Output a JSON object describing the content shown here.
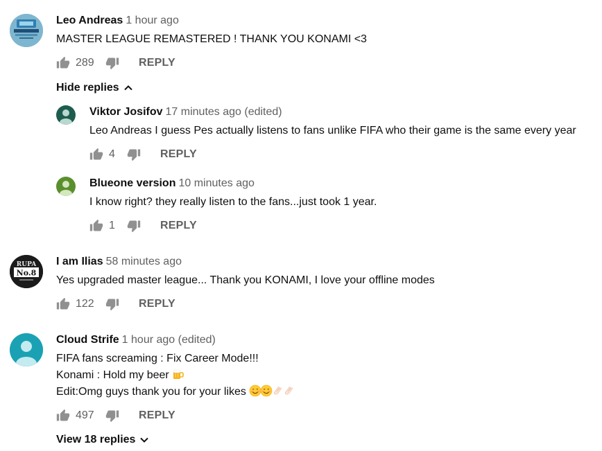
{
  "like_icon": "thumbs-up-icon",
  "dislike_icon": "thumbs-down-icon",
  "reply_label": "REPLY",
  "comments": [
    {
      "author": "Leo Andreas",
      "time": "1 hour ago",
      "text": "MASTER LEAGUE REMASTERED ! THANK YOU KONAMI <3",
      "likes": "289",
      "avatar_color": "#6fa8c4"
    },
    {
      "author": "I am Ilias",
      "time": "58 minutes ago",
      "text": "Yes upgraded master league... Thank you KONAMI, I love your offline modes",
      "likes": "122",
      "avatar_color": "#1b1b1b",
      "avatar_logo_top": "RUPA",
      "avatar_logo_main": "No.8"
    },
    {
      "author": "Cloud Strife",
      "time": "1 hour ago (edited)",
      "text_lines": [
        "FIFA fans screaming : Fix Career Mode!!!",
        "Konami : Hold my beer",
        "Edit:Omg guys thank you for your likes"
      ],
      "likes": "497",
      "avatar_color": "#1aa2b4"
    }
  ],
  "hide_replies_label": "Hide replies",
  "view_replies_label": "View 18 replies",
  "replies": [
    {
      "author": "Viktor Josifov",
      "time": "17 minutes ago (edited)",
      "text": "Leo Andreas I guess Pes actually listens to fans unlike FIFA who their game is the same every year",
      "likes": "4",
      "avatar_color": "#1e5c4f"
    },
    {
      "author": "Blueone version",
      "time": "10 minutes ago",
      "text": "I know right? they really listen to the fans...just took 1 year.",
      "likes": "1",
      "avatar_color": "#5b8f2e"
    }
  ]
}
